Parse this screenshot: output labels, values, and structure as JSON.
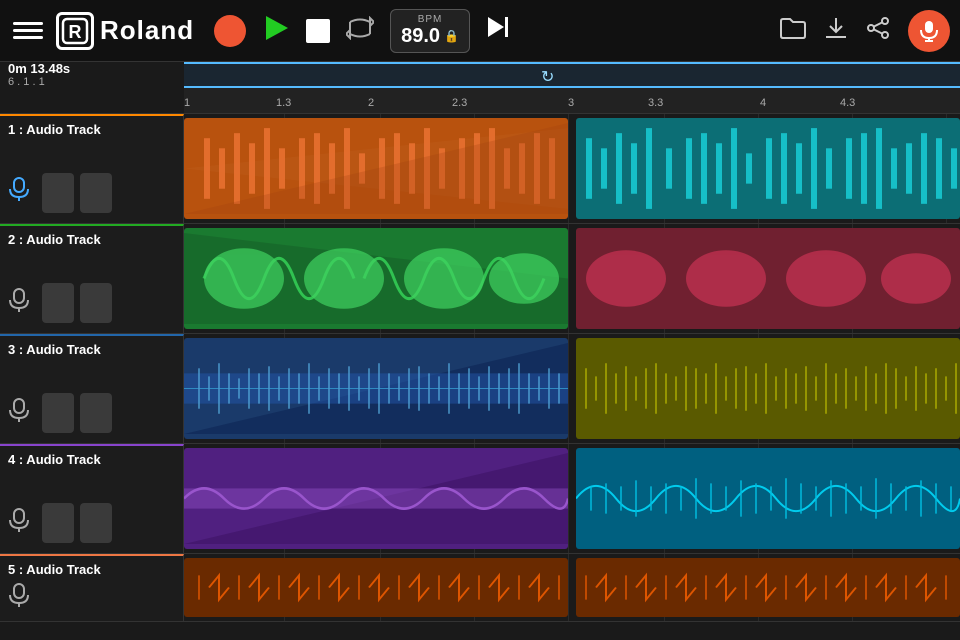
{
  "app": {
    "title": "Roland",
    "logo_text": "Roland"
  },
  "header": {
    "menu_label": "Menu",
    "record_label": "Record",
    "play_label": "Play",
    "stop_label": "Stop",
    "loop_label": "Loop",
    "bpm_label": "BPM",
    "bpm_value": "89.0",
    "next_label": "Next",
    "folder_label": "Folder",
    "download_label": "Download",
    "share_label": "Share",
    "mic_label": "Mic"
  },
  "timeline": {
    "time_main": "0m 13.48s",
    "time_bars": "6 . 1 . 1",
    "markers": [
      "1",
      "1.3",
      "2",
      "2.3",
      "3",
      "3.3",
      "4",
      "4.3"
    ]
  },
  "tracks": [
    {
      "id": 1,
      "name": "1 : Audio Track",
      "color_left": "#d4611a",
      "color_right": "#1bc8cc",
      "header_color": "#f80"
    },
    {
      "id": 2,
      "name": "2 : Audio Track",
      "color_left": "#229944",
      "color_right": "#a02040",
      "header_color": "#2a2"
    },
    {
      "id": 3,
      "name": "3 : Audio Track",
      "color_left": "#1a4d8a",
      "color_right": "#9a7a00",
      "header_color": "#26a"
    },
    {
      "id": 4,
      "name": "4 : Audio Track",
      "color_left": "#7040a0",
      "color_right": "#00aacc",
      "header_color": "#84c"
    },
    {
      "id": 5,
      "name": "5 : Audio Track",
      "color_left": "#c05828",
      "color_right": "#c05828",
      "header_color": "#e74"
    }
  ]
}
